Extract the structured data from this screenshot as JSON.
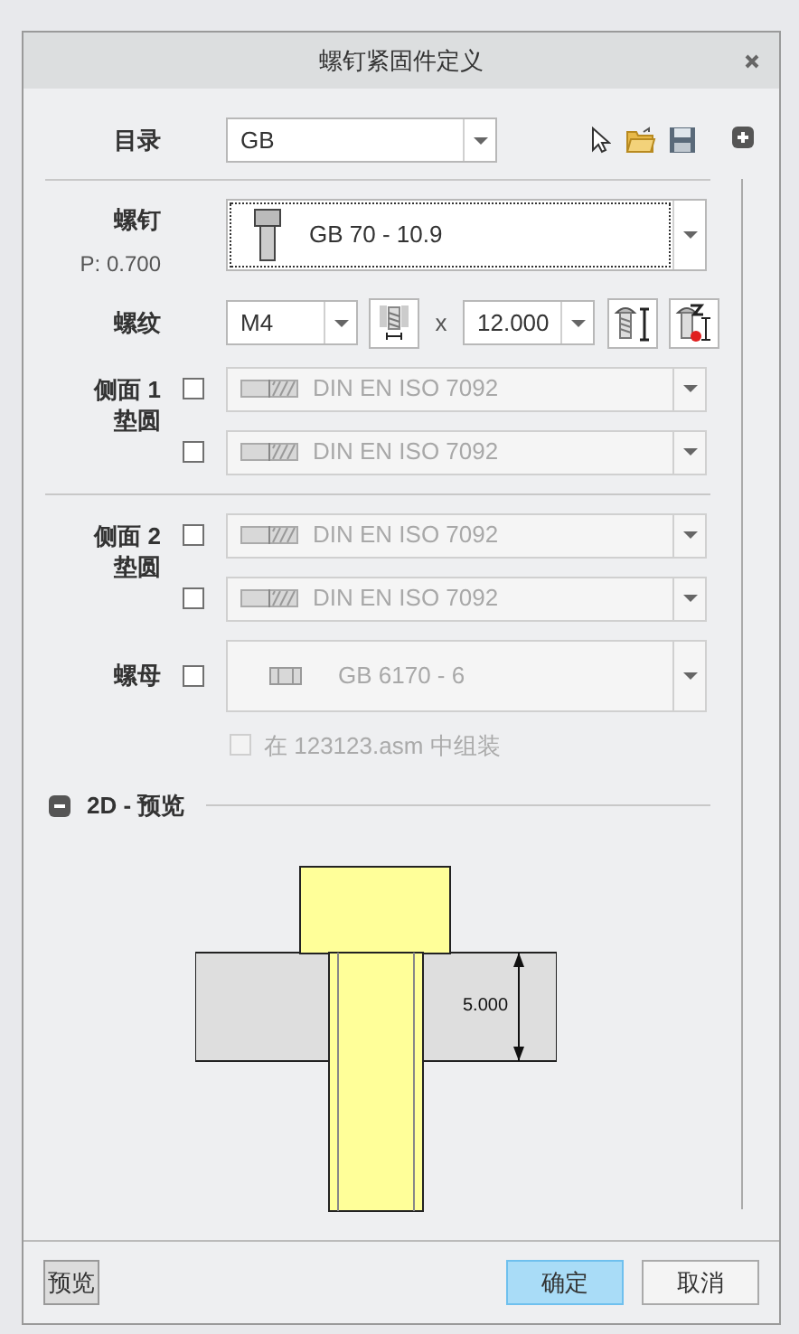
{
  "window": {
    "title": "螺钉紧固件定义"
  },
  "catalog": {
    "label": "目录",
    "value": "GB"
  },
  "screw": {
    "label": "螺钉",
    "pitch": "P: 0.700",
    "value": "GB 70 - 10.9",
    "focused": true
  },
  "thread": {
    "label": "螺纹",
    "size": "M4",
    "times": "x",
    "length": "12.000"
  },
  "washer_groups": [
    {
      "label": [
        "侧面 1",
        "垫圆"
      ],
      "items": [
        {
          "checked": false,
          "disabled": true,
          "value": "DIN EN ISO 7092"
        },
        {
          "checked": false,
          "disabled": true,
          "value": "DIN EN ISO 7092"
        }
      ]
    },
    {
      "label": [
        "侧面 2",
        "垫圆"
      ],
      "items": [
        {
          "checked": false,
          "disabled": true,
          "value": "DIN EN ISO 7092"
        },
        {
          "checked": false,
          "disabled": true,
          "value": "DIN EN ISO 7092"
        }
      ]
    }
  ],
  "nut": {
    "label": "螺母",
    "checked": false,
    "disabled": true,
    "value": "GB 6170 - 6"
  },
  "assemble": {
    "label": "在 123123.asm 中组装",
    "checked": false,
    "disabled": true
  },
  "preview": {
    "title": "2D - 预览",
    "expanded": true,
    "dimension": "5.000"
  },
  "buttons": [
    {
      "kind": "preview",
      "label": "预览",
      "default": false
    },
    {
      "kind": "ok",
      "label": "确定",
      "default": true
    },
    {
      "kind": "cancel",
      "label": "取消",
      "default": false
    }
  ]
}
